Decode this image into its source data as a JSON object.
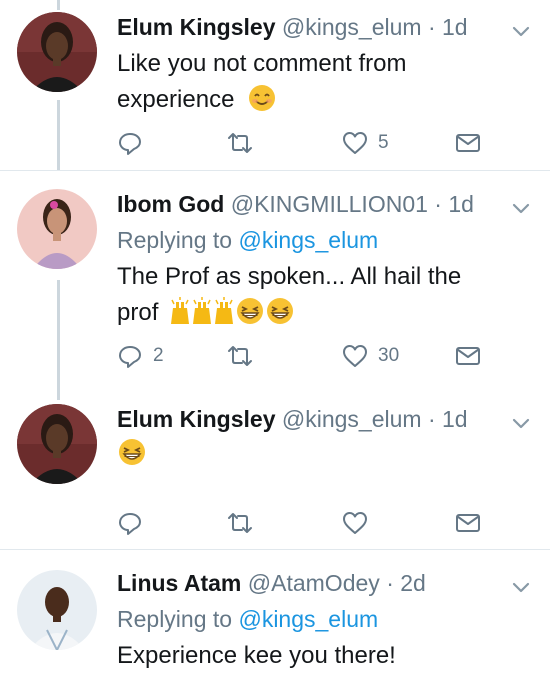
{
  "tweets": [
    {
      "name": "Elum Kingsley",
      "handle": "@kings_elum",
      "dot": "·",
      "time": "1d",
      "replying_prefix": "",
      "replying_mention": "",
      "text_lines": [
        "Like you not comment from",
        "experience"
      ],
      "emojis": [
        "smiling-face-emoji"
      ],
      "reply_count": "",
      "retweet_count": "",
      "like_count": "5",
      "colors": {
        "avatar_bg": "#6b2c2c"
      }
    },
    {
      "name": "Ibom God",
      "handle": "@KINGMILLION01",
      "dot": "·",
      "time": "1d",
      "replying_prefix": "Replying to",
      "replying_mention": "@kings_elum",
      "text_lines": [
        "The Prof as spoken...  All hail the",
        "prof"
      ],
      "emojis": [
        "raised-hands-emoji",
        "raised-hands-emoji",
        "raised-hands-emoji",
        "grinning-squinting-emoji",
        "grinning-squinting-emoji"
      ],
      "reply_count": "2",
      "retweet_count": "",
      "like_count": "30",
      "colors": {
        "avatar_bg": "#f1c9c4"
      }
    },
    {
      "name": "Elum Kingsley",
      "handle": "@kings_elum",
      "dot": "·",
      "time": "1d",
      "replying_prefix": "",
      "replying_mention": "",
      "text_lines": [],
      "emojis": [
        "grinning-squinting-emoji"
      ],
      "reply_count": "",
      "retweet_count": "",
      "like_count": "",
      "colors": {
        "avatar_bg": "#6b2c2c"
      }
    },
    {
      "name": "Linus Atam",
      "handle": "@AtamOdey",
      "dot": "·",
      "time": "2d",
      "replying_prefix": "Replying to",
      "replying_mention": "@kings_elum",
      "text_lines": [
        "Experience kee you there!"
      ],
      "emojis": [],
      "reply_count": "",
      "retweet_count": "",
      "like_count": "",
      "colors": {
        "avatar_bg": "#e8eef3"
      }
    }
  ],
  "colors": {
    "link": "#1b95e0",
    "secondary_text": "#657786",
    "divider": "#e1e8ed",
    "thread_line": "#ccd6dd"
  }
}
